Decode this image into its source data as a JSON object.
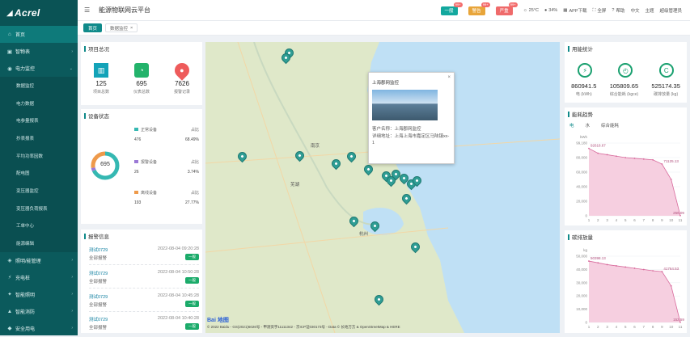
{
  "brand": {
    "logo_text": "Acrel"
  },
  "sidebar": {
    "items": [
      {
        "label": "首页",
        "icon": "home-icon"
      },
      {
        "label": "智物表",
        "icon": "meter-icon"
      },
      {
        "label": "电力监控",
        "icon": "power-icon"
      }
    ],
    "sub_items": [
      "数据监控",
      "电力数据",
      "电参量报表",
      "抄表报表",
      "平均功率因数",
      "配电图",
      "变压器监控",
      "变压器负荷报表",
      "工单中心",
      "能源编辑"
    ],
    "bottom_items": [
      {
        "label": "照明/能管理",
        "icon": "light-icon"
      },
      {
        "label": "充电桩",
        "icon": "charge-icon"
      },
      {
        "label": "智能照明",
        "icon": "bulb-icon"
      },
      {
        "label": "智能消防",
        "icon": "fire-icon"
      },
      {
        "label": "安全用电",
        "icon": "shield-icon"
      }
    ]
  },
  "header": {
    "title": "能源物联网云平台",
    "alarms": [
      {
        "label": "一般",
        "count": "99+",
        "color": "#13a89e"
      },
      {
        "label": "警告",
        "count": "99+",
        "color": "#e8a53a"
      },
      {
        "label": "严重",
        "count": "99+",
        "color": "#ef6a6a"
      }
    ],
    "weather": "25°C",
    "humidity": "34%",
    "app_download": "APP下载",
    "fullscreen": "全屏",
    "help": "帮助",
    "lang": "中文",
    "theme": "主题",
    "user": "超级管理员"
  },
  "tabs": [
    {
      "label": "首页"
    },
    {
      "label": "数据监控"
    }
  ],
  "overview": {
    "title": "项目总况",
    "stats": [
      {
        "value": "125",
        "label": "项目总数",
        "color": "#13a3b8"
      },
      {
        "value": "695",
        "label": "仪表总数",
        "color": "#23b36b"
      },
      {
        "value": "7626",
        "label": "报警记录",
        "color": "#ee5b5b"
      }
    ]
  },
  "device": {
    "title": "设备状态",
    "total": "695",
    "rows": [
      {
        "name": "正常设备",
        "pct_label": "占比",
        "count": "476",
        "pct": "68.49%",
        "color": "#35b8b2",
        "fraction": 0.6849
      },
      {
        "name": "报警设备",
        "pct_label": "占比",
        "count": "26",
        "pct": "3.74%",
        "color": "#9b79d6",
        "fraction": 0.0374
      },
      {
        "name": "离线设备",
        "pct_label": "占比",
        "count": "193",
        "pct": "27.77%",
        "color": "#ee9a4b",
        "fraction": 0.2777
      }
    ]
  },
  "alarm_info": {
    "title": "报警信息",
    "rows": [
      {
        "name": "测试0729",
        "time": "2022-08-04 09:20:28",
        "desc": "全部报警",
        "badge": "一般"
      },
      {
        "name": "测试0729",
        "time": "2022-08-04 10:50:28",
        "desc": "全部报警",
        "badge": "一般"
      },
      {
        "name": "测试0729",
        "time": "2022-08-04 10:45:28",
        "desc": "全部报警",
        "badge": "一般"
      },
      {
        "name": "测试0729",
        "time": "2022-08-04 10:40:28",
        "desc": "全部报警",
        "badge": "一般"
      }
    ]
  },
  "map": {
    "cities": [
      "南京",
      "杭州",
      "芜湖",
      "上海"
    ],
    "popup": {
      "title": "上海郡网监控",
      "customer": "客户名称：上海郡网监控",
      "address": "详细地址：上海上海市嘉定区马陆镇xx-1",
      "close": "×"
    },
    "copyright": "© 2022 Baidu - GS(2021)6026号 - 甲测资字11111342 - 京ICP证030173号 - Data © 长地万方 & OpenStreetMap & HERE",
    "baidu": "Bai 地图"
  },
  "usage": {
    "title": "用能统计",
    "items": [
      {
        "value": "860941.5",
        "label": "电 (kWh)"
      },
      {
        "value": "105809.65",
        "label": "综合能耗 (kgce)"
      },
      {
        "value": "525174.35",
        "label": "碳排放量 (kg)"
      }
    ]
  },
  "energy_trend": {
    "title": "能耗趋势",
    "tabs": [
      "电",
      "水",
      "综合能耗"
    ]
  },
  "carbon": {
    "title": "碳排放量"
  },
  "chart_data": [
    {
      "type": "area",
      "title": "",
      "ylabel": "kWh",
      "x": [
        "1",
        "2",
        "3",
        "4",
        "5",
        "6",
        "7",
        "8",
        "9",
        "10",
        "11"
      ],
      "values": [
        92618.67,
        86000,
        84000,
        82000,
        80000,
        79000,
        78000,
        77000,
        71125.13,
        50000,
        256.09
      ],
      "y_ticks": [
        "99,180",
        "80,000",
        "60,000",
        "40,000",
        "20,000",
        "0"
      ],
      "annotations": [
        "92618.67",
        "71125.13",
        "256.09"
      ]
    },
    {
      "type": "area",
      "title": "",
      "ylabel": "kg",
      "x": [
        "1",
        "2",
        "3",
        "4",
        "5",
        "6",
        "7",
        "8",
        "9",
        "10",
        "11"
      ],
      "values": [
        50398.13,
        49000,
        47500,
        46500,
        45500,
        44500,
        43500,
        42500,
        41764.53,
        30000,
        152.59
      ],
      "y_ticks": [
        "50,000",
        "40,000",
        "30,000",
        "20,000",
        "10,000",
        "0"
      ],
      "annotations": [
        "50398.13",
        "41764.53",
        "152.59"
      ]
    }
  ]
}
